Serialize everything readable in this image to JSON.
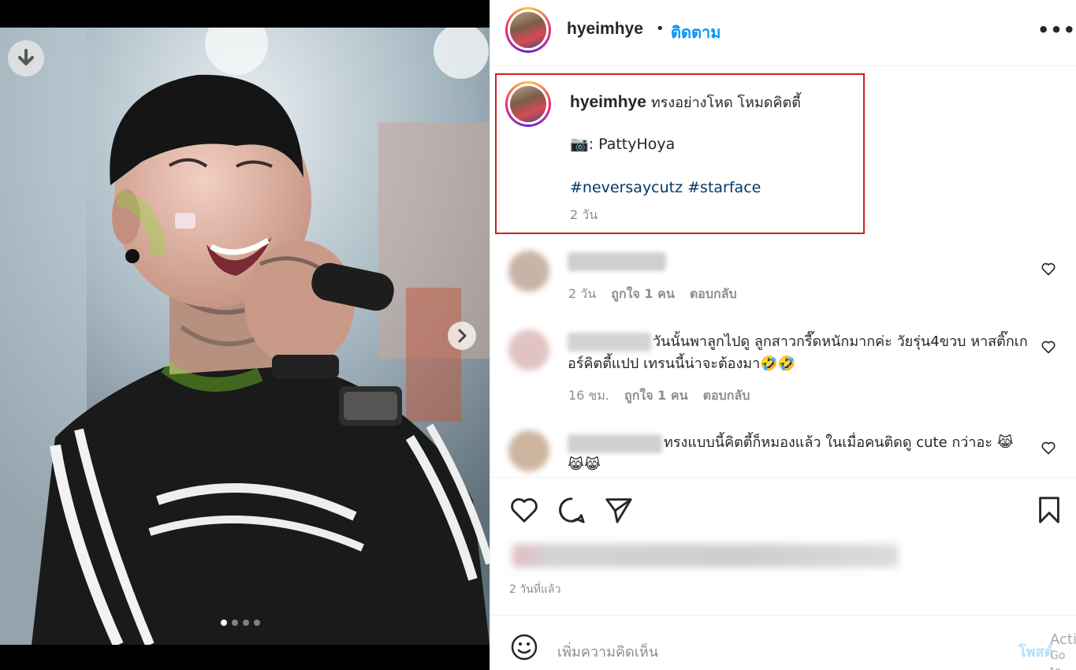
{
  "media": {
    "carousel_dots": [
      true,
      false,
      false,
      false
    ]
  },
  "header": {
    "username": "hyeimhye",
    "separator": "•",
    "follow_label": "ติดตาม",
    "more_label": "•••"
  },
  "caption": {
    "username": "hyeimhye",
    "text": "ทรงอย่างโหด โหมดคิตตี้",
    "photo_credit": "📷: PattyHoya",
    "hashtags": "#neversaycutz #starface",
    "time": "2 วัน"
  },
  "comments": [
    {
      "text": "",
      "time": "2 วัน",
      "likes": "ถูกใจ 1 คน",
      "reply": "ตอบกลับ"
    },
    {
      "text": "วันนั้นพาลูกไปดู ลูกสาวกรี๊ดหนักมากค่ะ วัยรุ่น4ขวบ หาสติ๊กเกอร์คิตตี้แปป เทรนนี้น่าจะต้องมา🤣🤣",
      "time": "16 ชม.",
      "likes": "ถูกใจ 1 คน",
      "reply": "ตอบกลับ"
    },
    {
      "text": "ทรงแบบนี้คิตตี้ก็หมองแล้ว ในเมื่อคนติดดู cute กว่าอะ 😹😹😹",
      "time": "",
      "likes": "",
      "reply": ""
    }
  ],
  "post_time": "2 วันที่แล้ว",
  "add_comment": {
    "placeholder": "เพิ่มความคิดเห็น",
    "post_label": "โพสต์"
  },
  "watermark": {
    "line1": "Acti",
    "line2": "Go to"
  }
}
